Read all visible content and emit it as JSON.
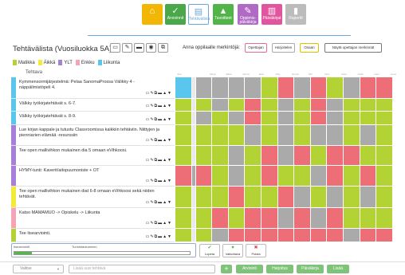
{
  "nav": [
    {
      "label": "",
      "icon": "home-icon",
      "color": "#f2b705"
    },
    {
      "label": "Arvioinnit",
      "icon": "check-icon",
      "color": "#4aa84a"
    },
    {
      "label": "Tehtävälista",
      "icon": "list-chart-icon",
      "color": "#ffffff"
    },
    {
      "label": "Tavoitteet",
      "icon": "mountain-icon",
      "color": "#52b348"
    },
    {
      "label": "Oppimis-päiväkirja",
      "icon": "pencil-icon",
      "color": "#b06ac4"
    },
    {
      "label": "Päiväkirjat",
      "icon": "book-icon",
      "color": "#e1549e"
    },
    {
      "label": "Raportit",
      "icon": "bar-chart-icon",
      "color": "#bcbcbc"
    }
  ],
  "title": "Tehtävälista (Vuosiluokka 5A)",
  "rating_label": "Anna oppilaalle merkintöjä:",
  "rate_buttons": [
    "Opettajan",
    "Harjoitelen",
    "Osaan"
  ],
  "show_teacher": "Näytä opettajan merkinnät",
  "legend": [
    {
      "label": "Matikka",
      "color": "#b3d334"
    },
    {
      "label": "Äikkä",
      "color": "#f4ea3a"
    },
    {
      "label": "YLT",
      "color": "#a87fd8"
    },
    {
      "label": "Enkku",
      "color": "#f5a3b5"
    },
    {
      "label": "Liikunta",
      "color": "#59c6ee"
    }
  ],
  "task_header": "Tehtava",
  "students": [
    "Jere",
    "Minja",
    "Elina",
    "Noora",
    "Eetu",
    "Otto",
    "Emma",
    "Siiri",
    "Niko",
    "Veeti",
    "Aada",
    "Lauri",
    "Leevi"
  ],
  "tasks": [
    {
      "text": "Kymmensormijärjestelmä: Pelaa SanomaProssa Välikky 4 - näppäilmistöpeli 4.",
      "color": "#59c6ee"
    },
    {
      "text": "Välkky työkirjatehtävät s. 6-7.",
      "color": "#59c6ee"
    },
    {
      "text": "Välkky työkirjatehtävät s. 8-9.",
      "color": "#59c6ee"
    },
    {
      "text": "Lue kirjan kappale ja tutustu Classroomissa kaikkiin tehtäviin. Niittyjen ja pienniarien elämää -resurssiin",
      "color": "#a87fd8"
    },
    {
      "text": "Tee open mallivihkon mukainen dia 5 omaan eVihkoosi.",
      "color": "#a87fd8"
    },
    {
      "text": "HYMY-tunti: Kaverit/aitopuumoniste + OT",
      "color": "#a87fd8"
    },
    {
      "text": "Tee open mallivihkon mukainen diat 6-8 omaan eVihkoosi sekä niiden tehtävät.",
      "color": "#f4ea3a"
    },
    {
      "text": "Katso MAMAMUO -> Opiskelu -> Liikunta",
      "color": "#f5a3b5"
    },
    {
      "text": "Tee itsearviointi.",
      "color": "#b3d334"
    }
  ],
  "grid_colors": {
    "L": "#59c6ee",
    "G": "#b3d334",
    "R": "#ee6e78",
    "Y": "#aaaaaa",
    "E": "#e9e9e9"
  },
  "grid": [
    "LEYYYYGRYRGYRR",
    "GEGYGRGYGRYGGG",
    "GEYGYRGYGRYGGG",
    "GEGGGYGYGYYGYG",
    "GEGGYGRYRGRRGG",
    "RYRGYGRGGYRGRG",
    "GEGGRGGRYGYGYG",
    "GEGRGRRYRYRGGG",
    "GEGYRRRRRRRYRR"
  ],
  "bottom": {
    "label1": "Itsearviointi",
    "label2": "Tunnistautuminen",
    "progress": 0.1
  },
  "status_buttons": [
    {
      "label": "Lopeta",
      "icon": "check-icon"
    },
    {
      "label": "Vaikuttava",
      "icon": "heart-icon"
    },
    {
      "label": "Poista",
      "icon": "close-icon"
    }
  ],
  "footer": {
    "select": "Valitse",
    "new_task_placeholder": "Lisää uusi tehtävä",
    "add": "+",
    "buttons": [
      "Arviointi",
      "Harjoitus",
      "Päiväkirja",
      "Lisää"
    ]
  }
}
